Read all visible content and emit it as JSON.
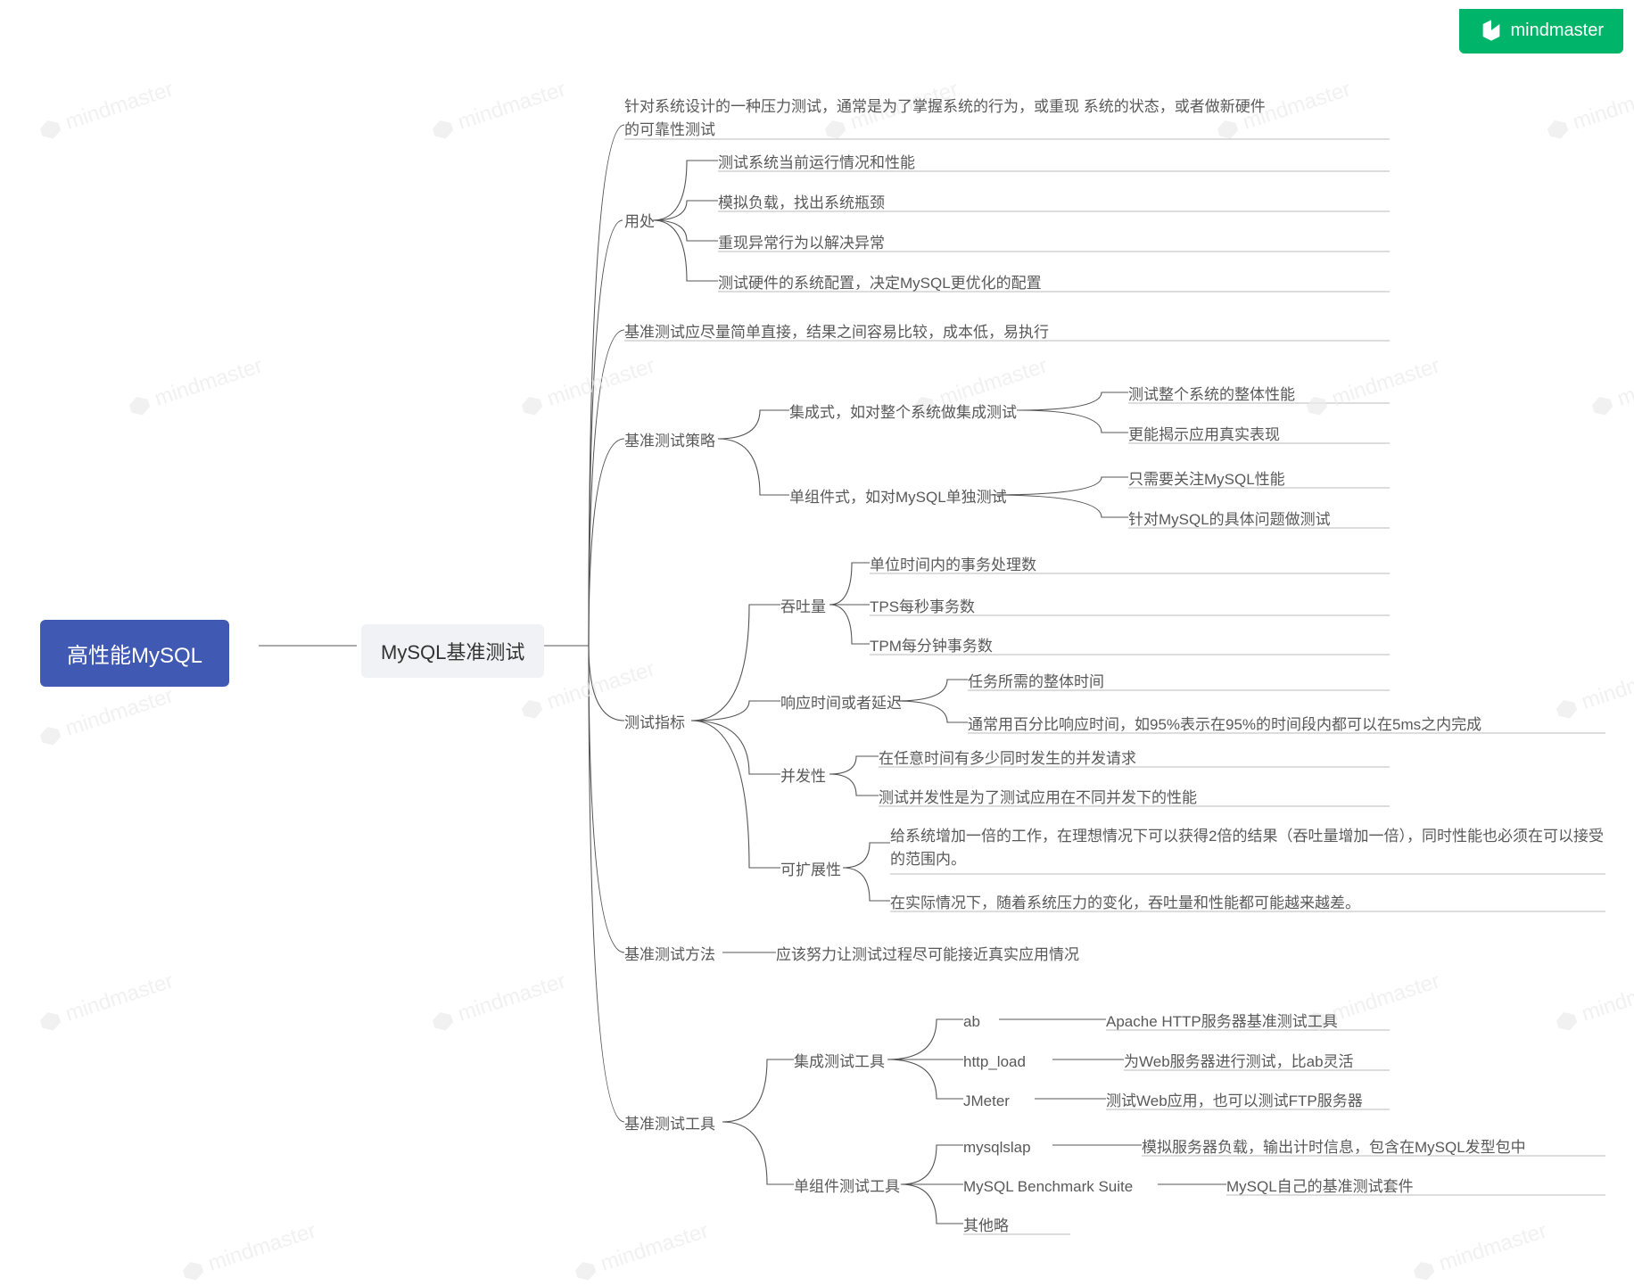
{
  "brand": "mindmaster",
  "watermark_text": "mindmaster",
  "root": "高性能MySQL",
  "level1": "MySQL基准测试",
  "b1": "针对系统设计的一种压力测试，通常是为了掌握系统的行为，或重现 系统的状态，或者做新硬件的可靠性测试",
  "b2": {
    "label": "用处",
    "items": [
      "测试系统当前运行情况和性能",
      "模拟负载，找出系统瓶颈",
      "重现异常行为以解决异常",
      "测试硬件的系统配置，决定MySQL更优化的配置"
    ]
  },
  "b3": "基准测试应尽量简单直接，结果之间容易比较，成本低，易执行",
  "b4": {
    "label": "基准测试策略",
    "items": [
      {
        "label": "集成式，如对整个系统做集成测试",
        "sub": [
          "测试整个系统的整体性能",
          "更能揭示应用真实表现"
        ]
      },
      {
        "label": "单组件式，如对MySQL单独测试",
        "sub": [
          "只需要关注MySQL性能",
          "针对MySQL的具体问题做测试"
        ]
      }
    ]
  },
  "b5": {
    "label": "测试指标",
    "items": [
      {
        "label": "吞吐量",
        "sub": [
          "单位时间内的事务处理数",
          "TPS每秒事务数",
          "TPM每分钟事务数"
        ]
      },
      {
        "label": "响应时间或者延迟",
        "sub": [
          "任务所需的整体时间",
          "通常用百分比响应时间，如95%表示在95%的时间段内都可以在5ms之内完成"
        ]
      },
      {
        "label": "并发性",
        "sub": [
          "在任意时间有多少同时发生的并发请求",
          "测试并发性是为了测试应用在不同并发下的性能"
        ]
      },
      {
        "label": "可扩展性",
        "sub": [
          "给系统增加一倍的工作，在理想情况下可以获得2倍的结果（吞吐量增加一倍），同时性能也必须在可以接受的范围内。",
          "在实际情况下，随着系统压力的变化，吞吐量和性能都可能越来越差。"
        ]
      }
    ]
  },
  "b6": {
    "label": "基准测试方法",
    "detail": "应该努力让测试过程尽可能接近真实应用情况"
  },
  "b7": {
    "label": "基准测试工具",
    "items": [
      {
        "label": "集成测试工具",
        "sub": [
          {
            "name": "ab",
            "desc": "Apache HTTP服务器基准测试工具"
          },
          {
            "name": "http_load",
            "desc": "为Web服务器进行测试，比ab灵活"
          },
          {
            "name": "JMeter",
            "desc": "测试Web应用，也可以测试FTP服务器"
          }
        ]
      },
      {
        "label": "单组件测试工具",
        "sub": [
          {
            "name": "mysqlslap",
            "desc": "模拟服务器负载，输出计时信息，包含在MySQL发型包中"
          },
          {
            "name": "MySQL Benchmark Suite",
            "desc": "MySQL自己的基准测试套件"
          },
          {
            "name": "其他略",
            "desc": ""
          }
        ]
      }
    ]
  }
}
